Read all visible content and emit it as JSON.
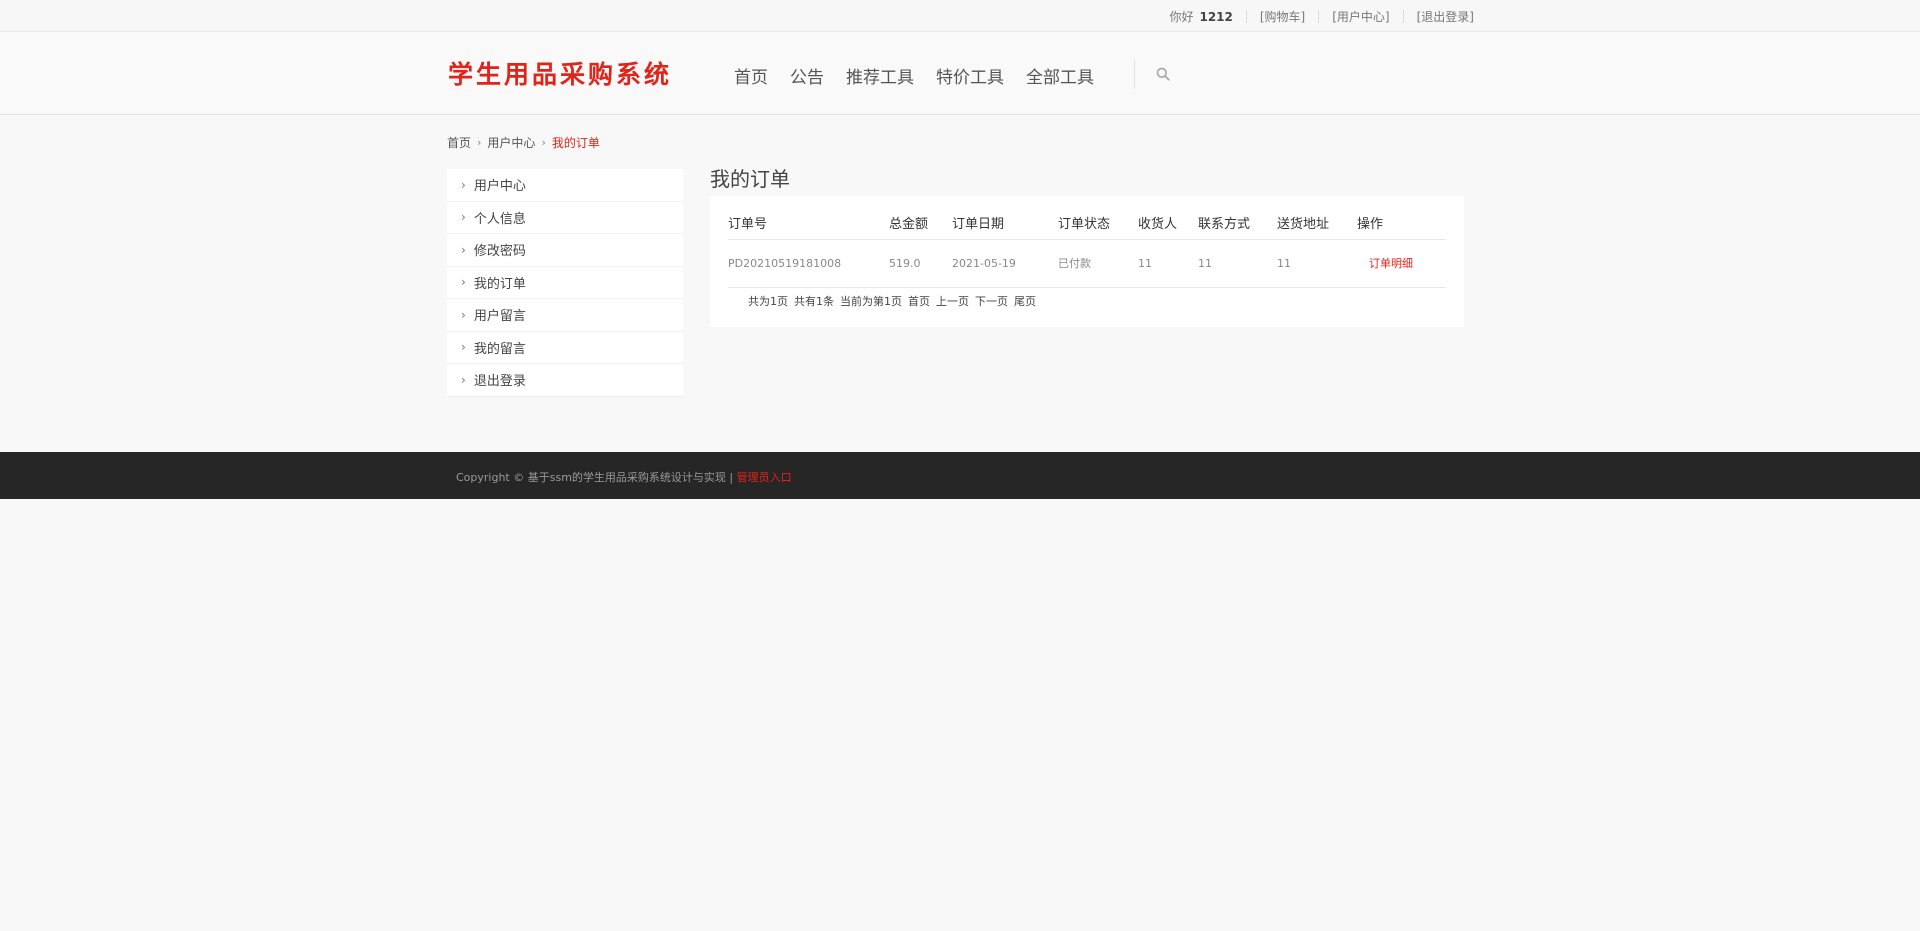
{
  "topbar": {
    "greeting": "你好",
    "username": "1212",
    "links": [
      "[购物车]",
      "[用户中心]",
      "[退出登录]"
    ]
  },
  "header": {
    "logo": "学生用品采购系统",
    "nav": [
      "首页",
      "公告",
      "推荐工具",
      "特价工具",
      "全部工具"
    ],
    "search_icon": "search-icon"
  },
  "breadcrumb": {
    "items": [
      "首页",
      "用户中心"
    ],
    "current": "我的订单"
  },
  "sidebar": {
    "items": [
      {
        "label": "用户中心"
      },
      {
        "label": "个人信息"
      },
      {
        "label": "修改密码"
      },
      {
        "label": "我的订单"
      },
      {
        "label": "用户留言"
      },
      {
        "label": "我的留言"
      },
      {
        "label": "退出登录"
      }
    ]
  },
  "main": {
    "title": "我的订单",
    "table": {
      "headers": [
        "订单号",
        "总金额",
        "订单日期",
        "订单状态",
        "收货人",
        "联系方式",
        "送货地址",
        "操作"
      ],
      "rows": [
        [
          "PD20210519181008",
          "519.0",
          "2021-05-19",
          "已付款",
          "11",
          "11",
          "11",
          "订单明细"
        ]
      ]
    },
    "pager": {
      "total_pages": "共为1页",
      "total_items": "共有1条",
      "current": "当前为第1页",
      "first": "首页",
      "prev": "上一页",
      "next": "下一页",
      "last": "尾页"
    }
  },
  "footer": {
    "copyright": "Copyright © 基于ssm的学生用品采购系统设计与实现 | ",
    "admin_link": "管理员入口"
  },
  "colors": {
    "accent": "#e2231a",
    "footer_bg": "#262626",
    "page_bg": "#f8f8f8"
  }
}
